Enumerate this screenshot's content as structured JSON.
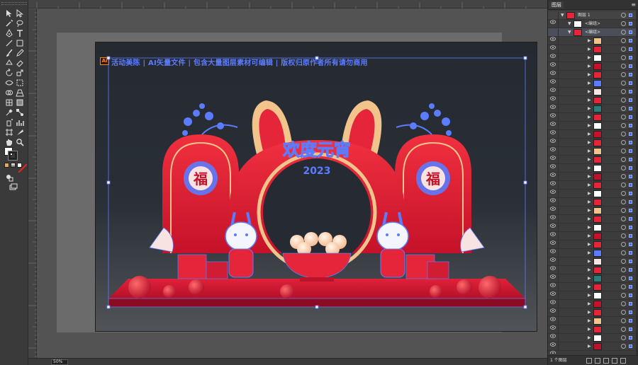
{
  "document": {
    "title_line": "活动美陈 | AI矢量文件 | 包含大量图层素材可编辑 | 版权归原作者所有请勿商用",
    "app_badge": "Ai"
  },
  "scene": {
    "headline": "欢度元宵",
    "year": "2023",
    "fu_char": "福",
    "colors": {
      "primary_red": "#e5253a",
      "dark_red": "#b9142b",
      "gold": "#f2c48c",
      "selection_blue": "#3b6cff",
      "floor": "#d21a35"
    }
  },
  "status": {
    "zoom": "50%"
  },
  "layers_panel": {
    "tab_label": "图层",
    "layer_top": "图层 1",
    "group_label_1": "<编组>",
    "group_label_2": "<编组>",
    "footer_count": "1 个图层",
    "icons": [
      "eye-icon",
      "lock-icon",
      "target-icon",
      "new-layer-icon",
      "delete-icon",
      "menu-icon"
    ]
  }
}
